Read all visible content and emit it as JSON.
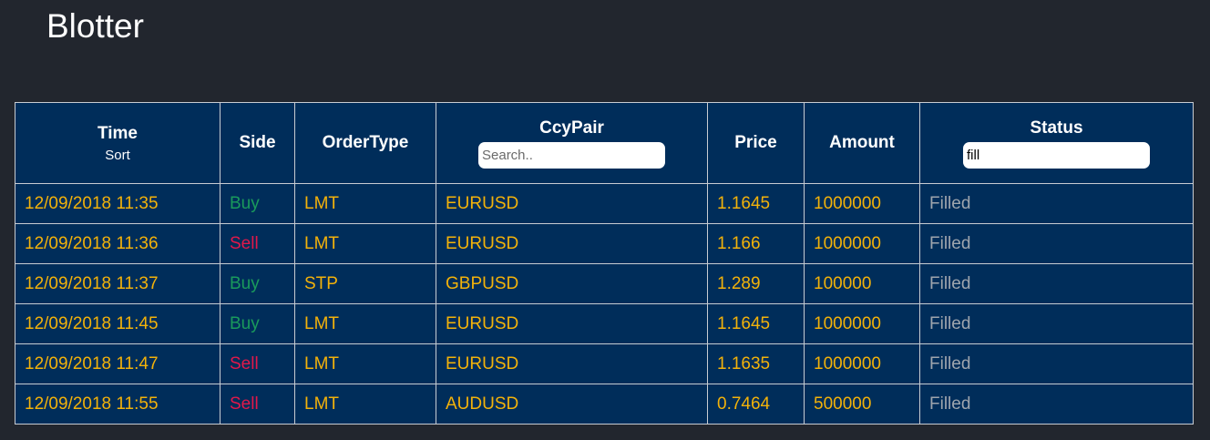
{
  "title": "Blotter",
  "columns": {
    "time": {
      "label": "Time",
      "sort_label": "Sort"
    },
    "side": {
      "label": "Side"
    },
    "order_type": {
      "label": "OrderType"
    },
    "ccy_pair": {
      "label": "CcyPair",
      "filter_placeholder": "Search..",
      "filter_value": ""
    },
    "price": {
      "label": "Price"
    },
    "amount": {
      "label": "Amount"
    },
    "status": {
      "label": "Status",
      "filter_value": "fill"
    }
  },
  "rows": [
    {
      "time": "12/09/2018 11:35",
      "side": "Buy",
      "order_type": "LMT",
      "ccy_pair": "EURUSD",
      "price": "1.1645",
      "amount": "1000000",
      "status": "Filled"
    },
    {
      "time": "12/09/2018 11:36",
      "side": "Sell",
      "order_type": "LMT",
      "ccy_pair": "EURUSD",
      "price": "1.166",
      "amount": "1000000",
      "status": "Filled"
    },
    {
      "time": "12/09/2018 11:37",
      "side": "Buy",
      "order_type": "STP",
      "ccy_pair": "GBPUSD",
      "price": "1.289",
      "amount": "100000",
      "status": "Filled"
    },
    {
      "time": "12/09/2018 11:45",
      "side": "Buy",
      "order_type": "LMT",
      "ccy_pair": "EURUSD",
      "price": "1.1645",
      "amount": "1000000",
      "status": "Filled"
    },
    {
      "time": "12/09/2018 11:47",
      "side": "Sell",
      "order_type": "LMT",
      "ccy_pair": "EURUSD",
      "price": "1.1635",
      "amount": "1000000",
      "status": "Filled"
    },
    {
      "time": "12/09/2018 11:55",
      "side": "Sell",
      "order_type": "LMT",
      "ccy_pair": "AUDUSD",
      "price": "0.7464",
      "amount": "500000",
      "status": "Filled"
    }
  ],
  "colors": {
    "background": "#22262e",
    "table_background": "#002d5a",
    "value_text": "#f3b20a",
    "buy": "#1a9a5c",
    "sell": "#e2184a",
    "status_text": "#9fa5ad"
  }
}
